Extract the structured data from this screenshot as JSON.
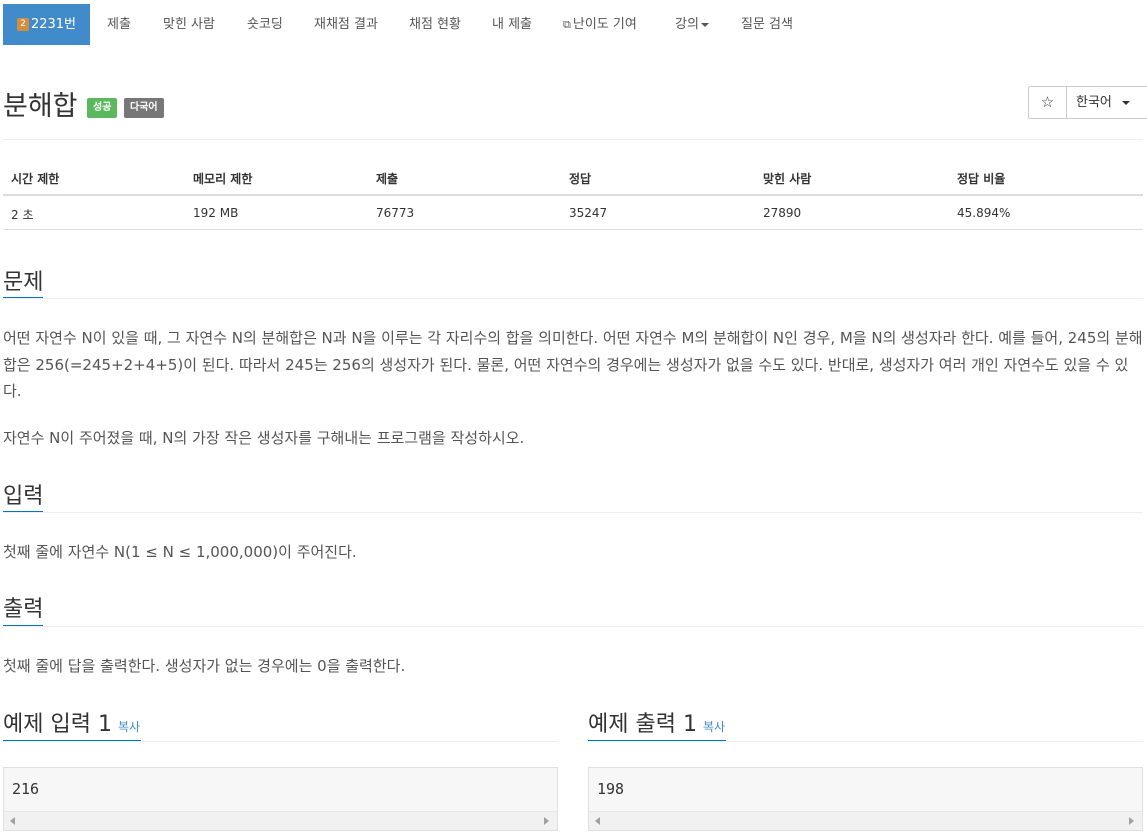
{
  "nav": {
    "problem_number": "2231번",
    "problem_tier_icon": "2",
    "items": [
      "제출",
      "맞힌 사람",
      "숏코딩",
      "재채점 결과",
      "채점 현황",
      "내 제출",
      "난이도 기여",
      "강의",
      "질문 검색"
    ]
  },
  "problem": {
    "title": "분해합",
    "labels": {
      "status": "성공",
      "lang": "다국어"
    },
    "star_icon": "☆",
    "language_select": "한국어"
  },
  "info_table": {
    "headers": [
      "시간 제한",
      "메모리 제한",
      "제출",
      "정답",
      "맞힌 사람",
      "정답 비율"
    ],
    "values": [
      "2 초",
      "192 MB",
      "76773",
      "35247",
      "27890",
      "45.894%"
    ]
  },
  "sections": {
    "problem_heading": "문제",
    "problem_text_1": "어떤 자연수 N이 있을 때, 그 자연수 N의 분해합은 N과 N을 이루는 각 자리수의 합을 의미한다. 어떤 자연수 M의 분해합이 N인 경우, M을 N의 생성자라 한다. 예를 들어, 245의 분해합은 256(=245+2+4+5)이 된다. 따라서 245는 256의 생성자가 된다. 물론, 어떤 자연수의 경우에는 생성자가 없을 수도 있다. 반대로, 생성자가 여러 개인 자연수도 있을 수 있다.",
    "problem_text_2": "자연수 N이 주어졌을 때, N의 가장 작은 생성자를 구해내는 프로그램을 작성하시오.",
    "input_heading": "입력",
    "input_text": "첫째 줄에 자연수 N(1 ≤ N ≤ 1,000,000)이 주어진다.",
    "output_heading": "출력",
    "output_text": "첫째 줄에 답을 출력한다. 생성자가 없는 경우에는 0을 출력한다."
  },
  "samples": {
    "input_title": "예제 입력 1",
    "output_title": "예제 출력 1",
    "copy_label": "복사",
    "input_value": "216",
    "output_value": "198"
  },
  "colors": {
    "nav_active": "#428bca",
    "success": "#5cb85c",
    "lang_label": "#777777",
    "section_underline": "#0076c0"
  }
}
